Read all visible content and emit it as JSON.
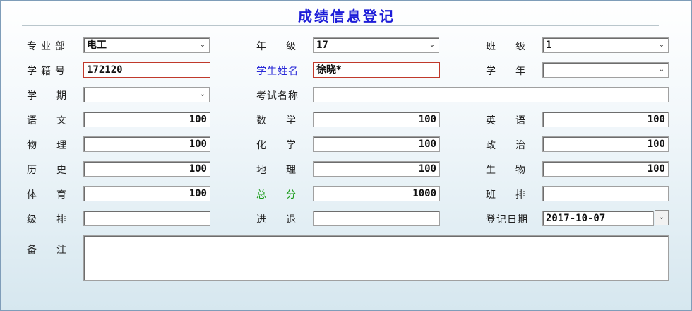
{
  "form": {
    "title": "成绩信息登记",
    "labels": {
      "department": "专业部",
      "grade": "年级",
      "class": "班级",
      "student_no": "学籍号",
      "student_name": "学生姓名",
      "school_year": "学年",
      "semester": "学期",
      "exam_name": "考试名称",
      "chinese": "语文",
      "math": "数学",
      "english": "英语",
      "physics": "物理",
      "chemistry": "化学",
      "politics": "政治",
      "history": "历史",
      "geography": "地理",
      "biology": "生物",
      "pe": "体育",
      "total": "总分",
      "class_rank": "班排",
      "grade_rank": "级排",
      "progress": "进退",
      "reg_date": "登记日期",
      "remarks": "备注"
    },
    "values": {
      "department": "电工",
      "grade": "17",
      "class": "1",
      "student_no": "172120",
      "student_name": "徐晓*",
      "school_year": "",
      "semester": "",
      "exam_name": "",
      "chinese": "100",
      "math": "100",
      "english": "100",
      "physics": "100",
      "chemistry": "100",
      "politics": "100",
      "history": "100",
      "geography": "100",
      "biology": "100",
      "pe": "100",
      "total": "1000",
      "class_rank": "",
      "grade_rank": "",
      "progress": "",
      "reg_date": "2017-10-07",
      "remarks": ""
    },
    "icons": {
      "dropdown": "chevron-down-icon",
      "date_picker": "calendar-dropdown-icon"
    },
    "colors": {
      "title": "#1d1dd8",
      "name_label": "#2a2ad8",
      "total_label": "#189a18",
      "required_border": "#c0392b"
    }
  }
}
